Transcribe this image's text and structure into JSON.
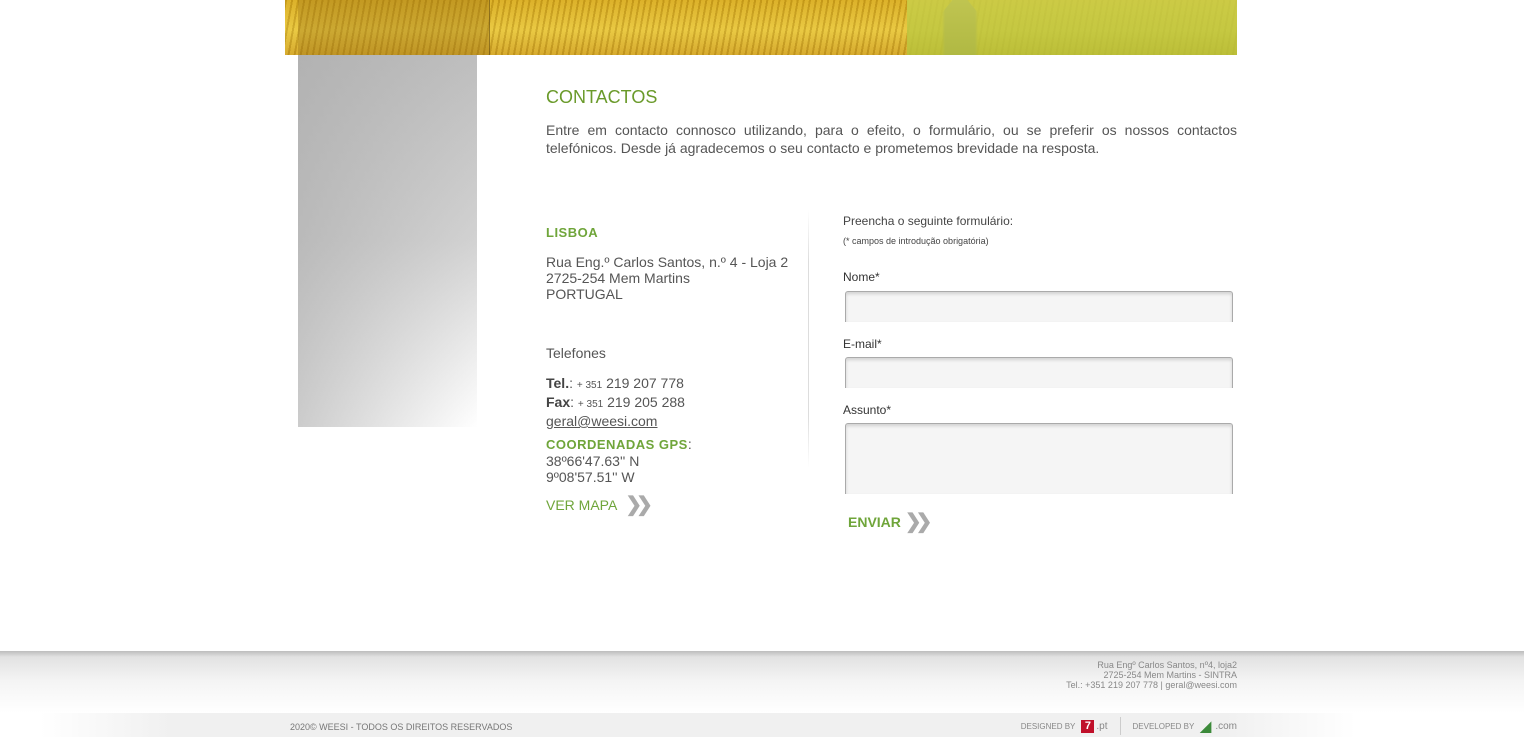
{
  "page": {
    "title": "CONTACTOS",
    "intro": "Entre em contacto connosco utilizando, para o efeito, o formulário, ou se preferir os nossos contactos telefónicos. Desde já agradecemos o seu contacto e prometemos brevidade na resposta."
  },
  "office": {
    "city": "LISBOA",
    "address_line1": "Rua Eng.º Carlos Santos, n.º 4 - Loja 2",
    "address_line2": "2725-254 Mem Martins",
    "address_line3": "PORTUGAL",
    "phones_title": "Telefones",
    "tel_label": "Tel.",
    "tel_prefix": "+ 351",
    "tel_number": "219 207 778",
    "fax_label": "Fax",
    "fax_prefix": "+ 351",
    "fax_number": "219 205 288",
    "email": "geral@weesi.com",
    "gps_title": "COORDENADAS GPS",
    "gps_lat": "38º66'47.63'' N",
    "gps_lon": "9º08'57.51'' W",
    "map_link": "VER MAPA"
  },
  "form": {
    "intro": "Preencha o seguinte formulário:",
    "note": "(* campos de introdução obrigatória)",
    "name_label": "Nome*",
    "email_label": "E-mail*",
    "subject_label": "Assunto*",
    "name_value": "",
    "email_value": "",
    "subject_value": "",
    "submit_label": "ENVIAR"
  },
  "footer": {
    "address1": "Rua Engº Carlos Santos, nº4, loja2",
    "address2": "2725-254 Mem Martins - SINTRA",
    "address3": "Tel.: +351 219 207 778 | geral@weesi.com",
    "copyright": "2020© WEESI - TODOS OS DIREITOS RESERVADOS",
    "designed_by": "DESIGNED BY",
    "designer_mark": "7",
    "designer_ext": ".pt",
    "developed_by": "DEVELOPED BY",
    "developer_ext": ".com"
  },
  "colors": {
    "accent_green": "#6fa53a",
    "heading_green": "#6a9a2a",
    "text": "#555555"
  },
  "icons": {
    "chevron": "double-chevron-right-icon"
  }
}
